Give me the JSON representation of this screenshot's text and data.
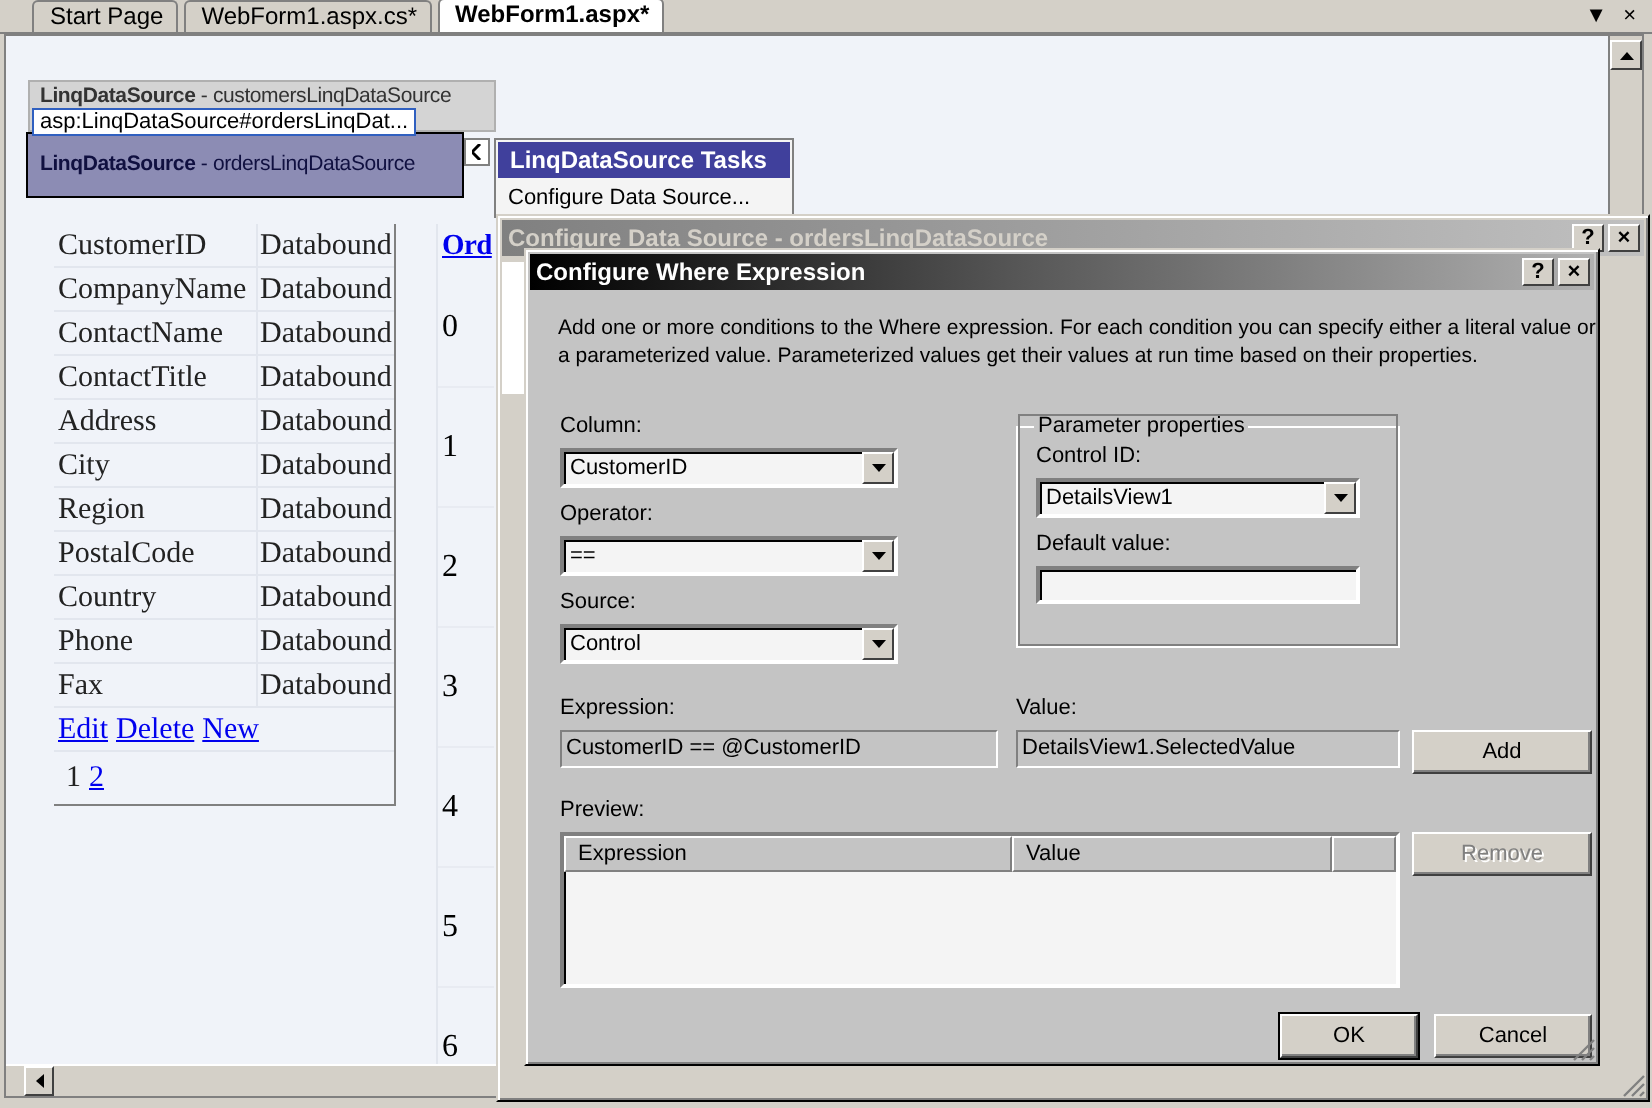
{
  "document_tabs": [
    {
      "label": "Start Page",
      "selected": false
    },
    {
      "label": "WebForm1.aspx.cs*",
      "selected": false
    },
    {
      "label": "WebForm1.aspx*",
      "selected": true
    }
  ],
  "tab_strip_buttons": {
    "list": "▼",
    "close": "×"
  },
  "designer": {
    "data_sources": [
      {
        "label": "**LinqDataSource** - customersLinqDataSource",
        "selected": false
      },
      {
        "label": "**LinqDataSource** - ordersLinqDataSource",
        "selected": true
      }
    ],
    "tag_tooltip": "asp:LinqDataSource#ordersLinqDat...",
    "tasks_panel": {
      "title": "LinqDataSource Tasks",
      "items": [
        "Configure Data Source..."
      ]
    },
    "details_view": {
      "rows": [
        {
          "field": "CustomerID",
          "value": "Databound"
        },
        {
          "field": "CompanyName",
          "value": "Databound"
        },
        {
          "field": "ContactName",
          "value": "Databound"
        },
        {
          "field": "ContactTitle",
          "value": "Databound"
        },
        {
          "field": "Address",
          "value": "Databound"
        },
        {
          "field": "City",
          "value": "Databound"
        },
        {
          "field": "Region",
          "value": "Databound"
        },
        {
          "field": "PostalCode",
          "value": "Databound"
        },
        {
          "field": "Country",
          "value": "Databound"
        },
        {
          "field": "Phone",
          "value": "Databound"
        },
        {
          "field": "Fax",
          "value": "Databound"
        }
      ],
      "links": [
        "Edit",
        "Delete",
        "New"
      ],
      "pager": [
        {
          "label": "1",
          "selected": true
        },
        {
          "label": "2",
          "selected": false
        }
      ]
    },
    "grid_view": {
      "header": "Ord",
      "rows": [
        "0",
        "1",
        "2",
        "3",
        "4",
        "5",
        "6"
      ]
    }
  },
  "outer_dialog": {
    "title": "Configure Data Source - ordersLinqDataSource",
    "active": false,
    "title_buttons": [
      "?",
      "×"
    ]
  },
  "where_dialog": {
    "title": "Configure Where Expression",
    "active": true,
    "title_buttons": [
      "?",
      "×"
    ],
    "description": "Add one or more conditions to the Where expression. For each condition you can specify either a literal value or a parameterized value. Parameterized values get their values at run time based on their properties.",
    "column": {
      "label": "Column:",
      "value": "CustomerID"
    },
    "operator": {
      "label": "Operator:",
      "value": "=="
    },
    "source": {
      "label": "Source:",
      "value": "Control"
    },
    "parameter_properties": {
      "title": "Parameter properties",
      "control_id": {
        "label": "Control ID:",
        "value": "DetailsView1"
      },
      "default_value": {
        "label": "Default value:"
      }
    },
    "expression": {
      "label": "Expression:",
      "value": "CustomerID == @CustomerID"
    },
    "value": {
      "label": "Value:",
      "value": "DetailsView1.SelectedValue"
    },
    "add_button": {
      "label": "Add",
      "disabled": false
    },
    "preview": {
      "label": "Preview:",
      "columns": [
        "Expression",
        "Value"
      ]
    },
    "remove_button": {
      "label": "Remove",
      "disabled": true
    },
    "ok_button": {
      "label": "OK",
      "default": true
    },
    "cancel_button": {
      "label": "Cancel",
      "default": false
    }
  }
}
